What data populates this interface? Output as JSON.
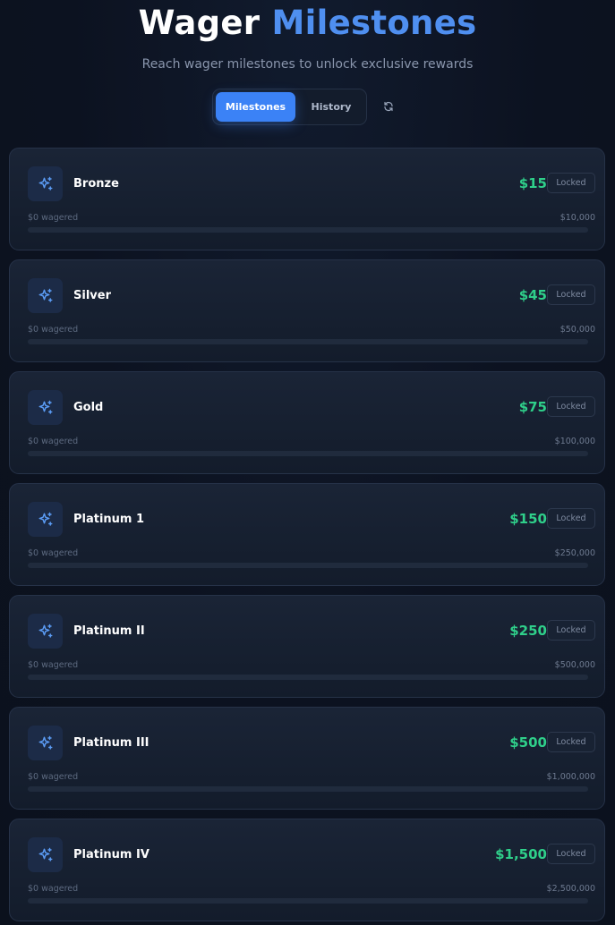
{
  "header": {
    "title_part1": "Wager",
    "title_part2": "Milestones",
    "subtitle": "Reach wager milestones to unlock exclusive rewards"
  },
  "tabs": [
    {
      "label": "Milestones",
      "active": true
    },
    {
      "label": "History",
      "active": false
    }
  ],
  "refresh_icon": "refresh-icon",
  "milestones": [
    {
      "name": "Bronze",
      "reward": "$15",
      "status": "Locked",
      "wagered": "$0 wagered",
      "target": "$10,000",
      "progress": 0
    },
    {
      "name": "Silver",
      "reward": "$45",
      "status": "Locked",
      "wagered": "$0 wagered",
      "target": "$50,000",
      "progress": 0
    },
    {
      "name": "Gold",
      "reward": "$75",
      "status": "Locked",
      "wagered": "$0 wagered",
      "target": "$100,000",
      "progress": 0
    },
    {
      "name": "Platinum 1",
      "reward": "$150",
      "status": "Locked",
      "wagered": "$0 wagered",
      "target": "$250,000",
      "progress": 0
    },
    {
      "name": "Platinum II",
      "reward": "$250",
      "status": "Locked",
      "wagered": "$0 wagered",
      "target": "$500,000",
      "progress": 0
    },
    {
      "name": "Platinum III",
      "reward": "$500",
      "status": "Locked",
      "wagered": "$0 wagered",
      "target": "$1,000,000",
      "progress": 0
    },
    {
      "name": "Platinum IV",
      "reward": "$1,500",
      "status": "Locked",
      "wagered": "$0 wagered",
      "target": "$2,500,000",
      "progress": 0
    }
  ],
  "milestone_icon": "sparkles-icon",
  "colors": {
    "accent": "#3b82f6",
    "reward": "#2fcf8a",
    "background": "#0c1220"
  }
}
